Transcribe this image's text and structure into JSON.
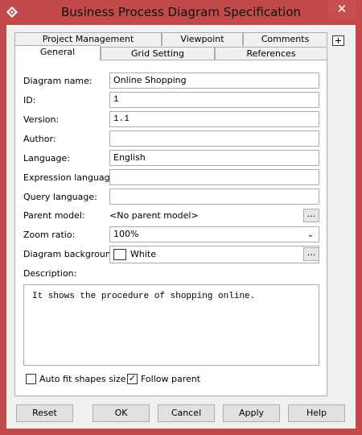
{
  "window": {
    "title": "Business Process Diagram Specification",
    "close_glyph": "✕"
  },
  "tabs": {
    "row1": [
      "Project Management",
      "Viewpoint",
      "Comments"
    ],
    "row2": [
      "General",
      "Grid Setting",
      "References"
    ]
  },
  "form": {
    "diagram_name": {
      "label": "Diagram name:",
      "value": "Online Shopping"
    },
    "id": {
      "label": "ID:",
      "value": "1"
    },
    "version": {
      "label": "Version:",
      "value": "1.1"
    },
    "author": {
      "label": "Author:",
      "value": ""
    },
    "language": {
      "label": "Language:",
      "value": "English"
    },
    "expression_language": {
      "label": "Expression language:",
      "value": ""
    },
    "query_language": {
      "label": "Query language:",
      "value": ""
    },
    "parent_model": {
      "label": "Parent model:",
      "value": "<No parent model>",
      "button": "..."
    },
    "zoom_ratio": {
      "label": "Zoom ratio:",
      "value": "100%",
      "arrow": "⌄"
    },
    "diagram_background": {
      "label": "Diagram background:",
      "value": "White",
      "button": "...",
      "swatch_color": "#ffffff"
    },
    "description": {
      "label": "Description:",
      "value": "It shows the procedure of shopping online."
    },
    "auto_fit": {
      "label": "Auto fit shapes size",
      "checked": false
    },
    "follow_parent": {
      "label": "Follow parent",
      "checked": true,
      "mark": "✓"
    }
  },
  "buttons": [
    "Reset",
    "OK",
    "Cancel",
    "Apply",
    "Help"
  ],
  "colors": {
    "title_bar": "#c34a4a",
    "dialog": "#f0f0f0"
  }
}
